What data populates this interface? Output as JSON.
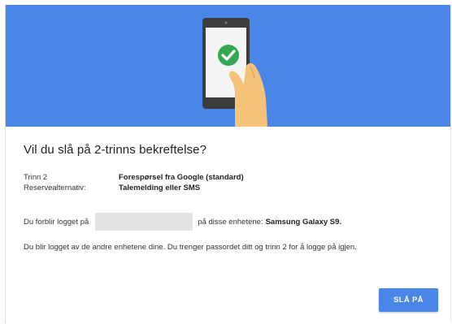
{
  "dialog": {
    "title": "Vil du slå på 2-trinns bekreftelse?",
    "step2_label": "Trinn 2",
    "step2_value": "Forespørsel fra Google (standard)",
    "backup_label": "Reservealternativ:",
    "backup_value": "Talemelding eller SMS",
    "devices_prefix": "Du forblir logget på",
    "devices_suffix": "på disse enhetene:",
    "device_name": "Samsung Galaxy S9.",
    "logout_text": "Du blir logget av de andre enhetene dine. Du trenger passordet ditt og trinn 2 for å logge på igjen.",
    "enable_button": "SLÅ PÅ"
  },
  "colors": {
    "hero_background": "#4a86e8",
    "button_background": "#4a86e8",
    "check_green": "#34a853",
    "hand_skin": "#f5c27a"
  },
  "icons": {
    "hero": "phone-with-checkmark-illustration"
  }
}
